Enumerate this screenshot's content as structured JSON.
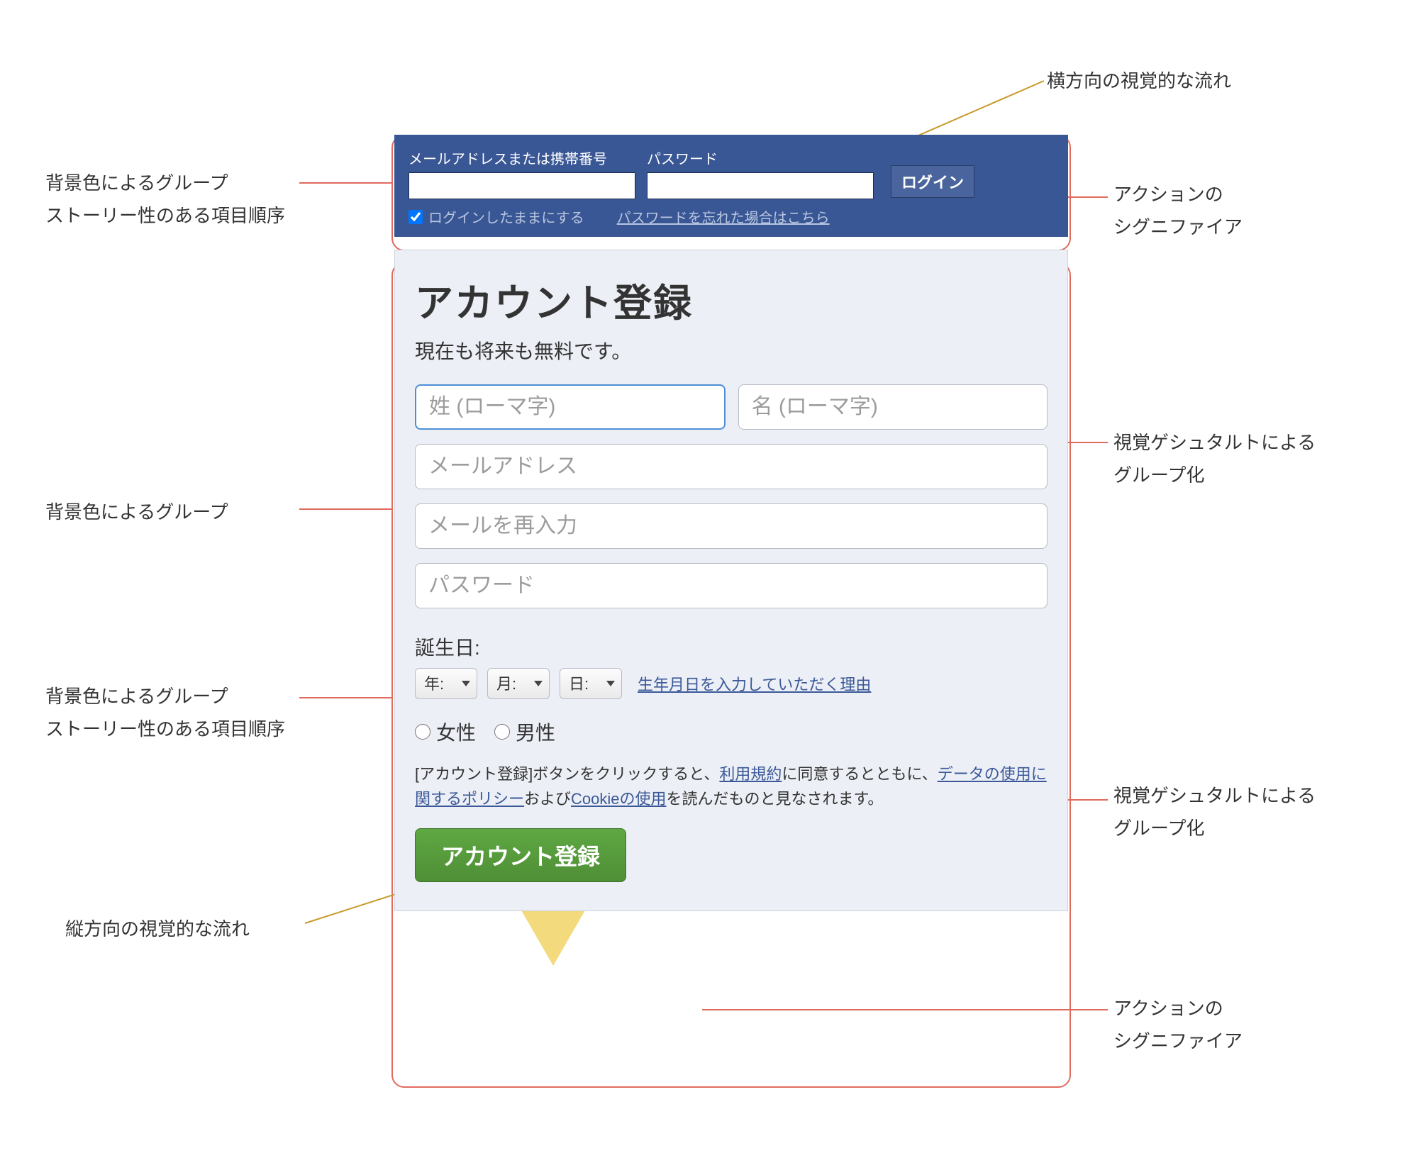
{
  "annotations": {
    "h_flow": "横方向の視覚的な流れ",
    "bg_group": "背景色によるグループ",
    "story_order": "ストーリー性のある項目順序",
    "action_signifier_1": "アクションの",
    "action_signifier_2": "シグニファイア",
    "gestalt_1": "視覚ゲシュタルトによる",
    "gestalt_2": "グループ化",
    "v_flow": "縦方向の視覚的な流れ"
  },
  "topbar": {
    "email_label": "メールアドレスまたは携帯番号",
    "password_label": "パスワード",
    "login_button": "ログイン",
    "stay_logged": "ログインしたままにする",
    "forgot": "パスワードを忘れた場合はこちら"
  },
  "main": {
    "heading": "アカウント登録",
    "subhead": "現在も将来も無料です。",
    "last_name_ph": "姓 (ローマ字)",
    "first_name_ph": "名 (ローマ字)",
    "email_ph": "メールアドレス",
    "email2_ph": "メールを再入力",
    "password_ph": "パスワード",
    "birth_label": "誕生日:",
    "year": "年:",
    "month": "月:",
    "day": "日:",
    "birth_why": "生年月日を入力していただく理由",
    "female": "女性",
    "male": "男性",
    "terms_1": "[アカウント登録]ボタンをクリックすると、",
    "terms_tos": "利用規約",
    "terms_2": "に同意するとともに、",
    "terms_data": "データの使用に関するポリシー",
    "terms_3": "および",
    "terms_cookie": "Cookieの使用",
    "terms_4": "を読んだものと見なされます。",
    "register_button": "アカウント登録"
  }
}
